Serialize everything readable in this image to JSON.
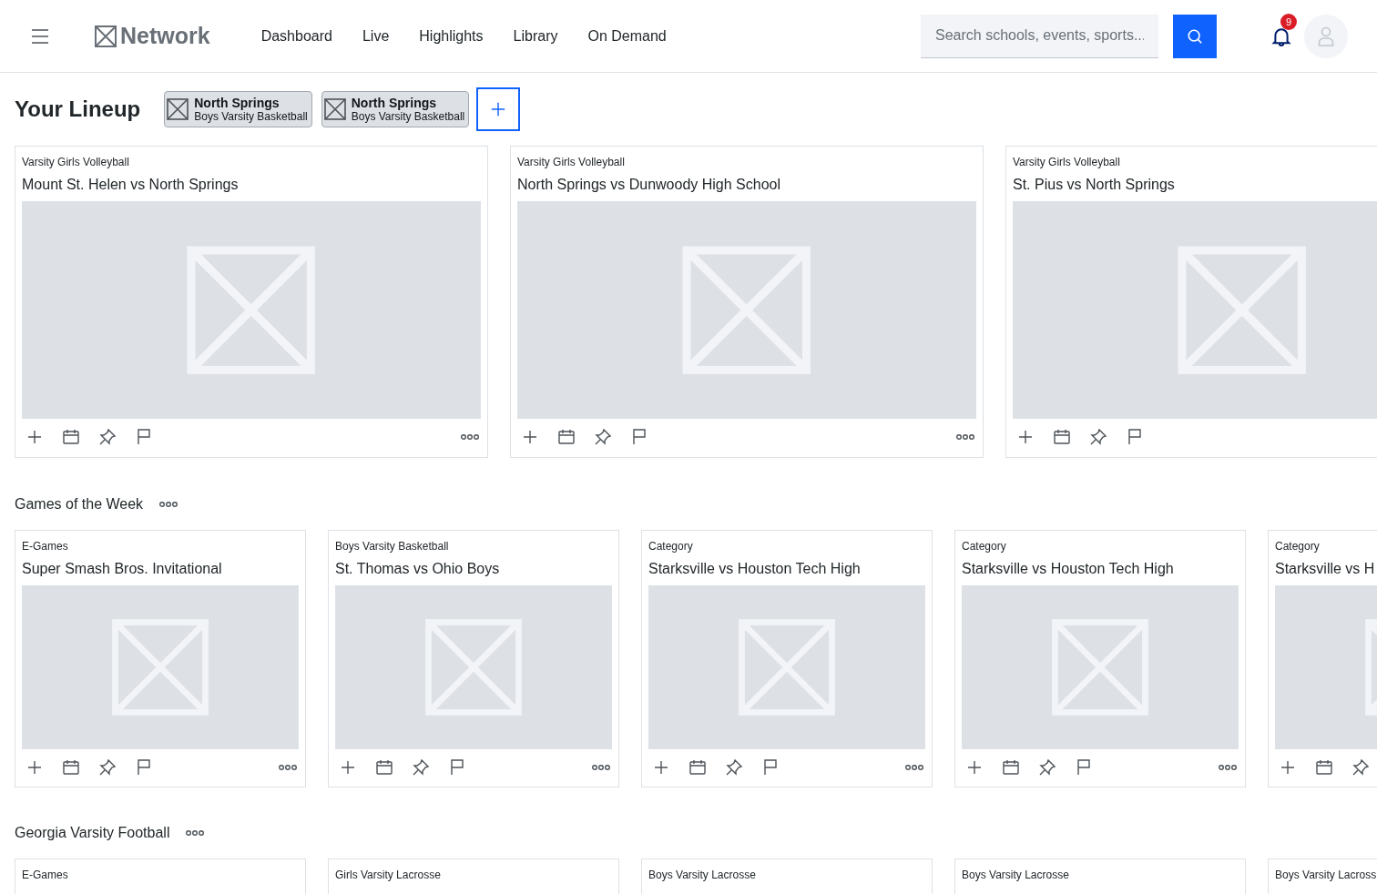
{
  "header": {
    "logo": "Network",
    "nav": [
      {
        "label": "Dashboard",
        "selected": false
      },
      {
        "label": "Live",
        "selected": false
      },
      {
        "label": "Highlights",
        "selected": false
      },
      {
        "label": "Library",
        "selected": false
      },
      {
        "label": "On Demand",
        "selected": false
      }
    ],
    "search": {
      "placeholder": "Search schools, events, sports..."
    },
    "notifications": "9"
  },
  "lineup": {
    "title": "Your Lineup",
    "teams": [
      {
        "name": "North Springs",
        "sport": "Boys Varsity Basketball"
      },
      {
        "name": "North Springs",
        "sport": "Boys Varsity Basketball"
      }
    ],
    "cards": [
      {
        "category": "Varsity Girls Volleyball",
        "title": "Mount St. Helen vs North Springs"
      },
      {
        "category": "Varsity Girls Volleyball",
        "title": "North Springs vs Dunwoody High School"
      },
      {
        "category": "Varsity Girls Volleyball",
        "title": "St. Pius vs North Springs"
      }
    ]
  },
  "sections": [
    {
      "title": "Games of the Week",
      "cards": [
        {
          "category": "E-Games",
          "title": "Super Smash Bros. Invitational"
        },
        {
          "category": "Boys Varsity Basketball",
          "title": "St. Thomas vs Ohio Boys"
        },
        {
          "category": "Category",
          "title": "Starksville vs Houston Tech High"
        },
        {
          "category": "Category",
          "title": "Starksville vs Houston Tech High"
        },
        {
          "category": "Category",
          "title": "Starksville vs H"
        }
      ]
    },
    {
      "title": "Georgia Varsity Football",
      "cards": [
        {
          "category": "E-Games"
        },
        {
          "category": "Girls Varsity Lacrosse"
        },
        {
          "category": "Boys Varsity Lacrosse"
        },
        {
          "category": "Boys Varsity Lacrosse"
        },
        {
          "category": "Boys Varsity Lacross"
        }
      ]
    }
  ]
}
